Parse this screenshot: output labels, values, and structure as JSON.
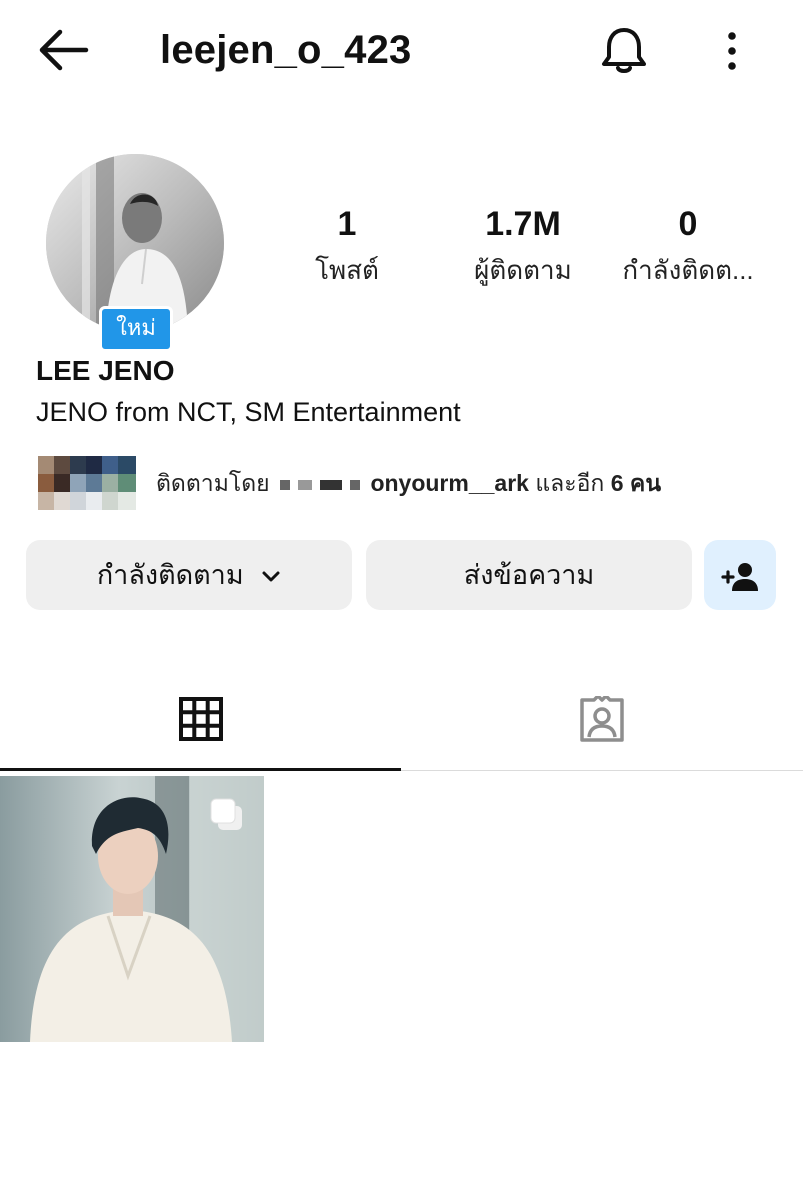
{
  "header": {
    "username": "leejen_o_423",
    "back_icon": "arrow-left-icon",
    "bell_icon": "bell-icon",
    "more_icon": "more-vertical-icon"
  },
  "profile": {
    "badge": "ใหม่",
    "display_name": "LEE JENO",
    "bio": "JENO from NCT, SM Entertainment"
  },
  "stats": [
    {
      "value": "1",
      "label": "โพสต์"
    },
    {
      "value": "1.7M",
      "label": "ผู้ติดตาม"
    },
    {
      "value": "0",
      "label": "กำลังติดต..."
    }
  ],
  "followed_by": {
    "prefix": "ติดตามโดย",
    "account": "onyourm__ark",
    "suffix": "และอีก",
    "count": "6 คน"
  },
  "actions": {
    "following": "กำลังติดตาม",
    "message": "ส่งข้อความ",
    "add_user_icon": "add-user-icon"
  },
  "tabs": {
    "grid_icon": "grid-icon",
    "tagged_icon": "tagged-person-icon"
  },
  "colors": {
    "badge_blue": "#2196e8",
    "button_gray": "#efefef",
    "add_user_bg": "#e0f0fe"
  }
}
